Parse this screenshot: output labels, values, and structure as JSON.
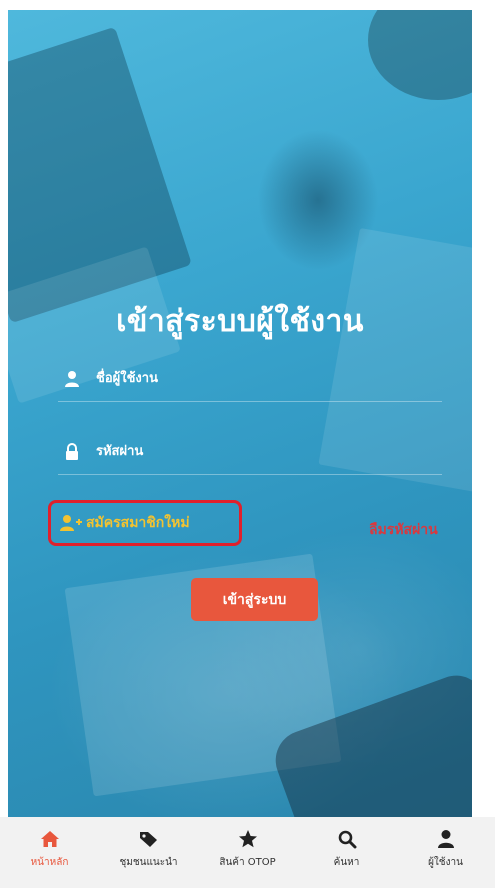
{
  "login": {
    "title": "เข้าสู่ระบบผู้ใช้งาน",
    "username_label": "ชื่อผู้ใช้งาน",
    "password_label": "รหัสผ่าน",
    "register_label": "สมัครสมาชิกใหม่",
    "forgot_label": "ลืมรหัสผ่าน",
    "submit_label": "เข้าสู่ระบบ"
  },
  "tabbar": {
    "items": [
      {
        "label": "หน้าหลัก",
        "icon": "home-icon",
        "active": true
      },
      {
        "label": "ชุมชนแนะนำ",
        "icon": "tag-icon",
        "active": false
      },
      {
        "label": "สินค้า OTOP",
        "icon": "star-icon",
        "active": false
      },
      {
        "label": "ค้นหา",
        "icon": "search-icon",
        "active": false
      },
      {
        "label": "ผู้ใช้งาน",
        "icon": "user-icon",
        "active": false
      }
    ]
  },
  "colors": {
    "accent": "#e8573d",
    "register_text": "#f2c331",
    "highlight_border": "#e0202c",
    "forgot_text": "#d9393f"
  }
}
